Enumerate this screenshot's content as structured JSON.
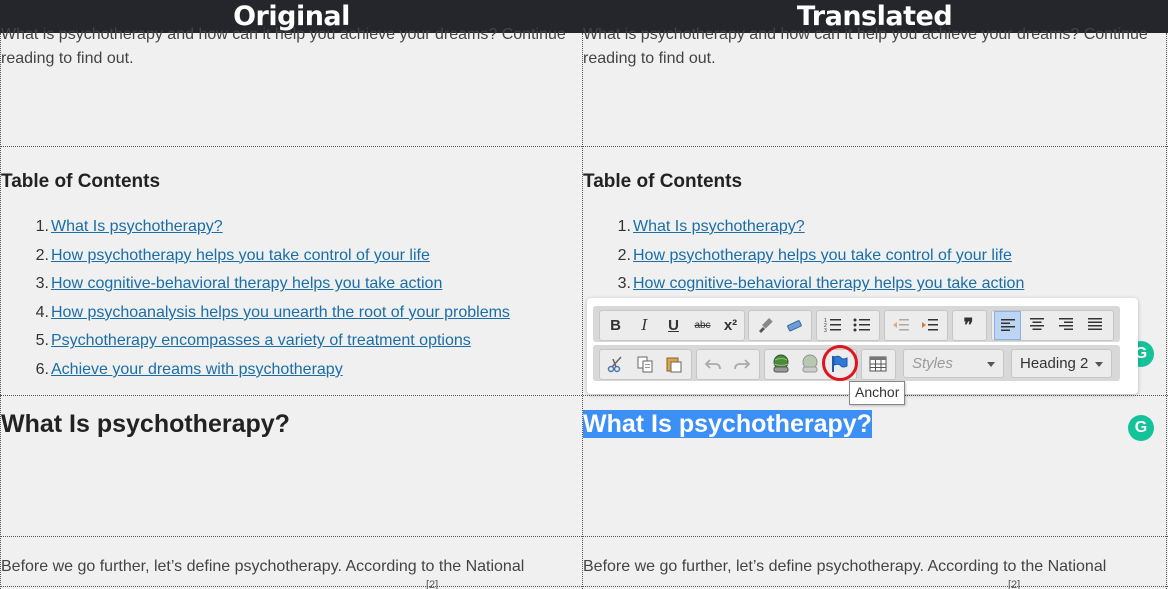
{
  "header": {
    "original": "Original",
    "translated": "Translated"
  },
  "columns": {
    "original": {
      "intro_line1": "What is psychotherapy and how can it help you achieve your dreams? Continue",
      "intro_line2": "reading to find out.",
      "toc_title": "Table of Contents",
      "toc": [
        {
          "num": "1.",
          "text": "What Is psychotherapy?"
        },
        {
          "num": "2.",
          "text": "How psychotherapy helps you take control of your life"
        },
        {
          "num": "3.",
          "text": "How cognitive-behavioral therapy helps you take action"
        },
        {
          "num": "4.",
          "text": "How psychoanalysis helps you unearth the root of your problems"
        },
        {
          "num": "5.",
          "text": "Psychotherapy encompasses a variety of treatment options"
        },
        {
          "num": "6.",
          "text": "Achieve your dreams with psychotherapy"
        }
      ],
      "heading": "What Is psychotherapy?",
      "para_line1": "Before we go further, let’s define psychotherapy. According to the National",
      "footnote": "[2]"
    },
    "translated": {
      "intro_line1": "What is psychotherapy and how can it help you achieve your dreams? Continue",
      "intro_line2": "reading to find out.",
      "toc_title": "Table of Contents",
      "toc": [
        {
          "num": "1.",
          "text": "What Is psychotherapy?"
        },
        {
          "num": "2.",
          "text": "How psychotherapy helps you take control of your life"
        },
        {
          "num": "3.",
          "text": "How cognitive-behavioral therapy helps you take action"
        }
      ],
      "heading": "What Is psychotherapy?",
      "para_line1": "Before we go further, let’s define psychotherapy. According to the National",
      "footnote": "[2]"
    }
  },
  "toolbar": {
    "styles_placeholder": "Styles",
    "format_value": "Heading 2",
    "tooltip": "Anchor",
    "glyphs": {
      "bold": "B",
      "italic": "I",
      "underline": "U",
      "strike": "abc",
      "superscript": "x²",
      "blockquote": "❞",
      "grammarly": "G"
    }
  },
  "colors": {
    "header_bg": "#24262b",
    "link": "#1a6ea8",
    "selection": "#3b8ff5",
    "grammarly": "#15c39a",
    "highlight": "#e0141e"
  }
}
